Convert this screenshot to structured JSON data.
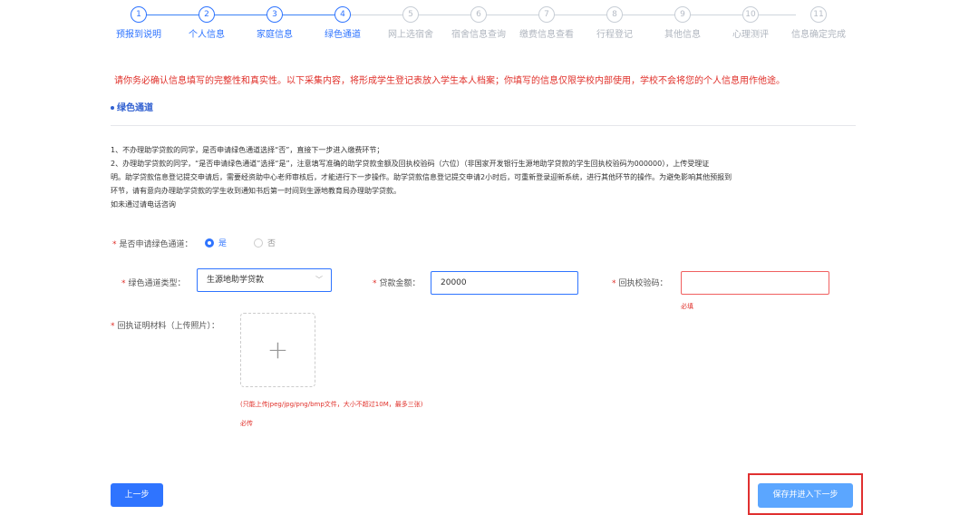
{
  "steps": [
    {
      "num": "1",
      "label": "预报到说明",
      "done": true
    },
    {
      "num": "2",
      "label": "个人信息",
      "done": true
    },
    {
      "num": "3",
      "label": "家庭信息",
      "done": true
    },
    {
      "num": "4",
      "label": "绿色通道",
      "done": true
    },
    {
      "num": "5",
      "label": "网上选宿舍",
      "done": false
    },
    {
      "num": "6",
      "label": "宿舍信息查询",
      "done": false
    },
    {
      "num": "7",
      "label": "缴费信息查看",
      "done": false
    },
    {
      "num": "8",
      "label": "行程登记",
      "done": false
    },
    {
      "num": "9",
      "label": "其他信息",
      "done": false
    },
    {
      "num": "10",
      "label": "心理测评",
      "done": false
    },
    {
      "num": "11",
      "label": "信息确定完成",
      "done": false
    }
  ],
  "notice": "请你务必确认信息填写的完整性和真实性。以下采集内容，将形成学生登记表放入学生本人档案；你填写的信息仅限学校内部使用，学校不会将您的个人信息用作他途。",
  "section_title": "绿色通道",
  "instructions": [
    "1、不办理助学贷款的同学，是否申请绿色通道选择“否”，直接下一步进入缴费环节；",
    "2、办理助学贷款的同学，“是否申请绿色通道”选择“是”，注意填写准确的助学贷款金额及回执校验码（六位）（非国家开发银行生源地助学贷款的学生回执校验码为000000），上传受理证",
    "明。助学贷款信息登记提交申请后，需要经资助中心老师审核后，才能进行下一步操作。助学贷款信息登记提交申请2小时后，可重新登录迎新系统，进行其他环节的操作。为避免影响其他预报到",
    "环节，请有意向办理助学贷款的学生收到通知书后第一时间到生源地教育局办理助学贷款。",
    "如未通过请电话咨询"
  ],
  "form": {
    "apply_label": "是否申请绿色通道：",
    "yes_label": "是",
    "no_label": "否",
    "type_label": "绿色通道类型：",
    "type_value": "生源地助学贷款",
    "amount_label": "贷款金额：",
    "amount_value": "20000",
    "code_label": "回执校验码：",
    "code_value": "",
    "code_error": "必填",
    "upload_label": "回执证明材料（上传照片）：",
    "upload_hint": "(只能上传jpeg/jpg/png/bmp文件，大小不超过10M，最多三张)",
    "upload_error": "必传"
  },
  "buttons": {
    "prev": "上一步",
    "next": "保存并进入下一步"
  },
  "colors": {
    "primary": "#2f74ff",
    "error": "#e0302a",
    "next_button": "#5ba6ff"
  }
}
